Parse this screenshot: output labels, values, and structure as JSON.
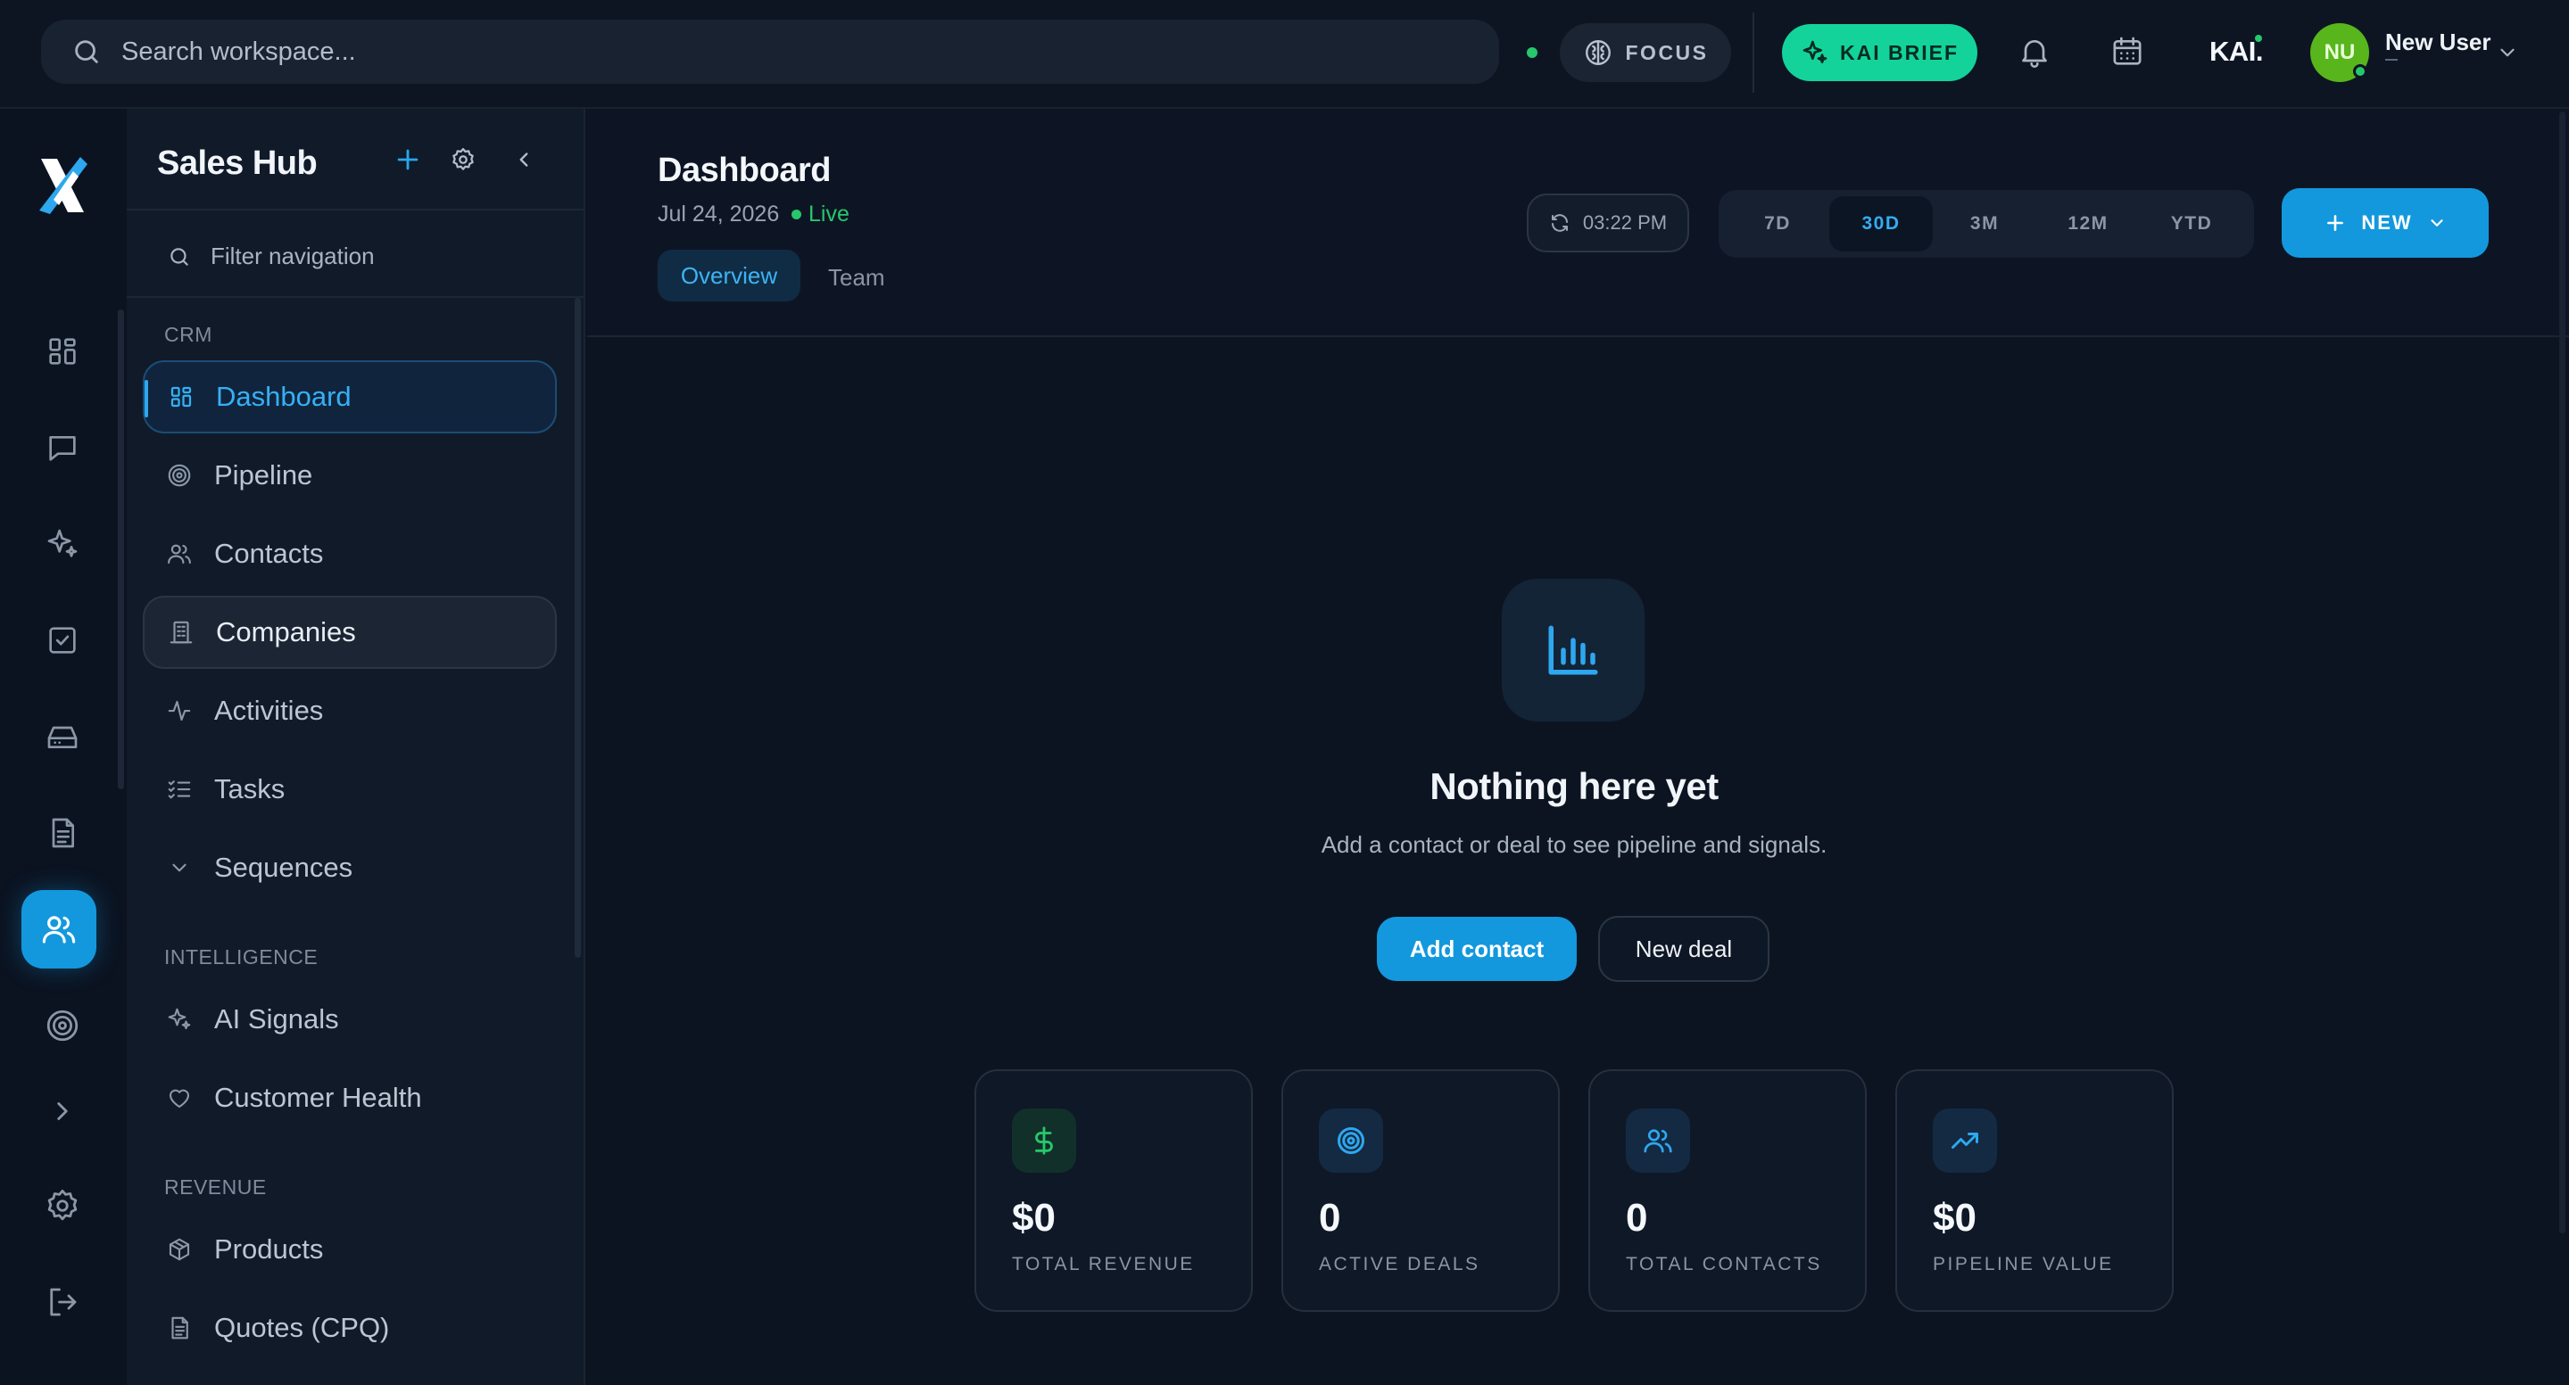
{
  "topbar": {
    "search_placeholder": "Search workspace...",
    "focus_label": "FOCUS",
    "kai_brief_label": "KAI BRIEF",
    "brand_text": "KAI.",
    "user": {
      "initials": "NU",
      "name": "New User",
      "subtitle": "—"
    }
  },
  "sidebar": {
    "title": "Sales Hub",
    "filter_placeholder": "Filter navigation",
    "sections": [
      {
        "label": "CRM",
        "items": [
          {
            "label": "Dashboard",
            "icon": "grid-icon",
            "state": "active"
          },
          {
            "label": "Pipeline",
            "icon": "target-icon"
          },
          {
            "label": "Contacts",
            "icon": "users-icon"
          },
          {
            "label": "Companies",
            "icon": "building-icon",
            "state": "hover"
          },
          {
            "label": "Activities",
            "icon": "activity-icon"
          },
          {
            "label": "Tasks",
            "icon": "list-check-icon"
          },
          {
            "label": "Sequences",
            "icon": "chevron-down-icon"
          }
        ]
      },
      {
        "label": "INTELLIGENCE",
        "items": [
          {
            "label": "AI Signals",
            "icon": "sparkle-icon"
          },
          {
            "label": "Customer Health",
            "icon": "heart-icon"
          }
        ]
      },
      {
        "label": "REVENUE",
        "items": [
          {
            "label": "Products",
            "icon": "box-icon"
          },
          {
            "label": "Quotes (CPQ)",
            "icon": "document-icon"
          }
        ]
      }
    ]
  },
  "header": {
    "title": "Dashboard",
    "date": "Jul 24, 2026",
    "live_label": "Live",
    "tabs": [
      {
        "label": "Overview",
        "active": true
      },
      {
        "label": "Team",
        "active": false
      }
    ],
    "time": "03:22 PM",
    "ranges": [
      {
        "label": "7D",
        "active": false
      },
      {
        "label": "30D",
        "active": true
      },
      {
        "label": "3M",
        "active": false
      },
      {
        "label": "12M",
        "active": false
      },
      {
        "label": "YTD",
        "active": false
      }
    ],
    "new_label": "NEW"
  },
  "empty_state": {
    "title": "Nothing here yet",
    "subtitle": "Add a contact or deal to see pipeline and signals.",
    "primary_label": "Add contact",
    "secondary_label": "New deal"
  },
  "stats": [
    {
      "value": "$0",
      "label": "TOTAL REVENUE",
      "icon": "dollar-icon",
      "color": "#27c76b"
    },
    {
      "value": "0",
      "label": "ACTIVE DEALS",
      "icon": "target-icon",
      "color": "#2ea7ef"
    },
    {
      "value": "0",
      "label": "TOTAL CONTACTS",
      "icon": "users-icon",
      "color": "#2ea7ef"
    },
    {
      "value": "$0",
      "label": "PIPELINE VALUE",
      "icon": "trending-up-icon",
      "color": "#2ea7ef"
    }
  ],
  "colors": {
    "accent": "#1398de",
    "success": "#14d39a",
    "live": "#27c76b",
    "background": "#0c1422"
  }
}
